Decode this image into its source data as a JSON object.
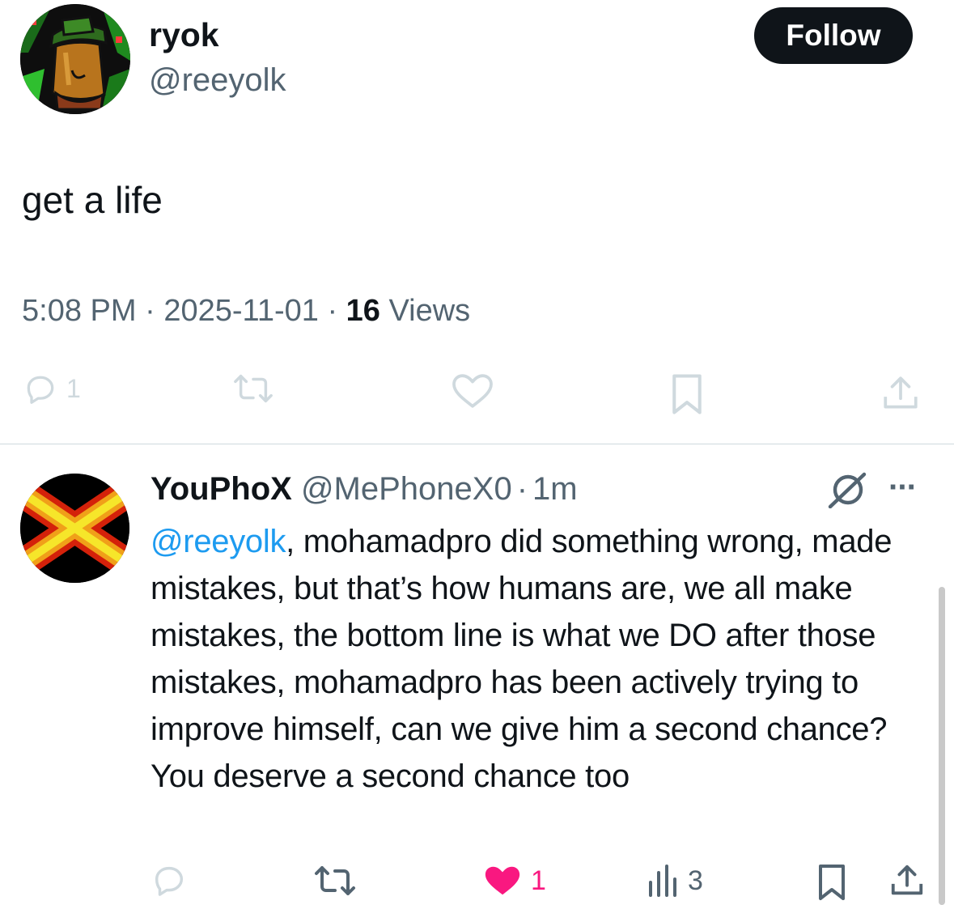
{
  "tweet": {
    "author_name": "ryok",
    "author_handle": "@reeyolk",
    "follow_label": "Follow",
    "text": "get a life",
    "time": "5:08 PM",
    "sep1": "·",
    "date": "2025-11-01",
    "sep2": "·",
    "views_count": "16",
    "views_label": "Views",
    "actions": {
      "reply_count": "1"
    }
  },
  "reply": {
    "author_name": "YouPhoX",
    "author_handle": "@MePhoneX0",
    "sep": "·",
    "time": "1m",
    "more_label": "···",
    "mention": "@reeyolk",
    "text": ", mohamadpro did something wrong, made mistakes, but that’s how humans are, we all make mistakes, the bottom line is what we DO after those mistakes, mohamadpro has been actively trying to improve himself, can we give him a second chance?\nYou deserve a second chance too",
    "actions": {
      "like_count": "1",
      "views_count": "3"
    }
  },
  "colors": {
    "accent": "#1d9bf0",
    "like": "#f91880",
    "muted": "#536471",
    "text": "#0f1419"
  }
}
